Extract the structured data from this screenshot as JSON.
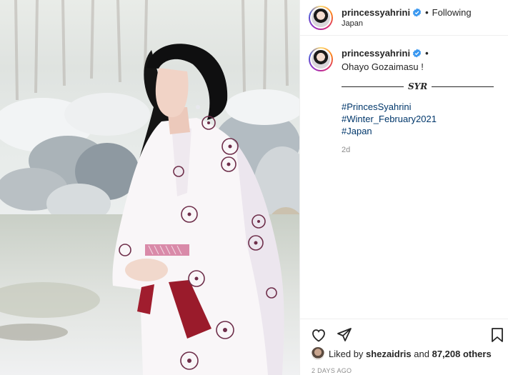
{
  "post": {
    "username": "princessyahrini",
    "follow_status": "Following",
    "location": "Japan",
    "caption": {
      "username": "princessyahrini",
      "text": "Ohayo Gozaimasu !",
      "signature": "SYR",
      "hashtags": [
        "#PrincesSyahrini",
        "#Winter_February2021",
        "#Japan"
      ],
      "age": "2d"
    },
    "likes": {
      "prefix": "Liked by",
      "user": "shezaidris",
      "mid": "and",
      "count": "87,208 others"
    },
    "timestamp": "2 DAYS AGO"
  },
  "icons": {
    "verified": "verified-badge-icon",
    "like": "heart-icon",
    "share": "paper-plane-icon",
    "save": "bookmark-icon"
  },
  "colors": {
    "link": "#00376b",
    "verified": "#3897f0",
    "muted": "#8e8e8e",
    "text": "#262626"
  }
}
